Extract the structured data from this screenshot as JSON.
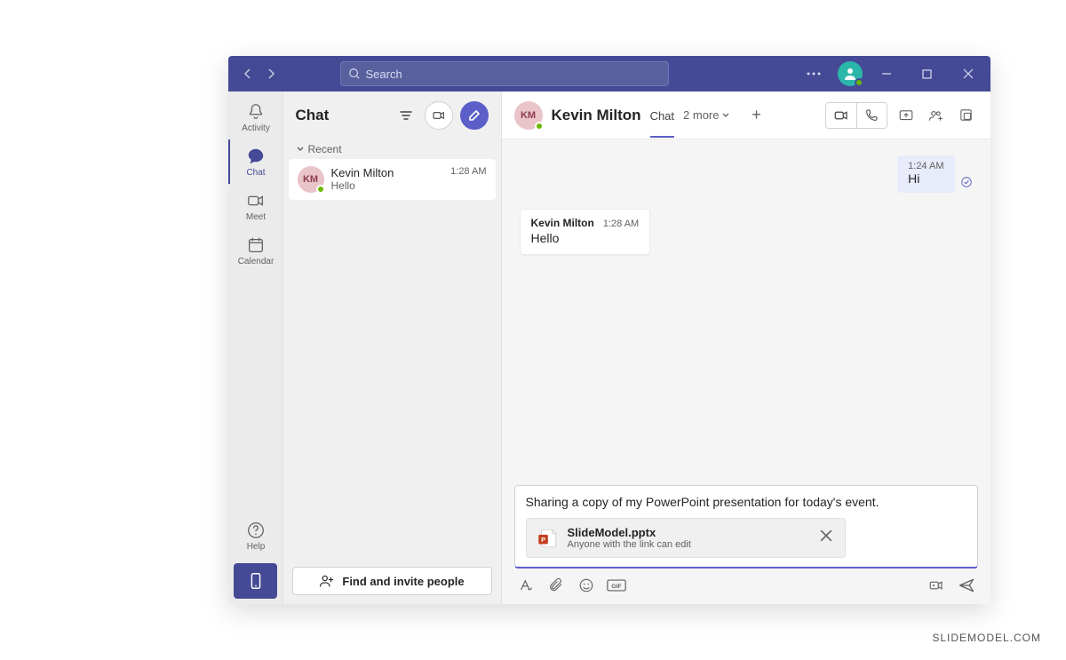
{
  "titlebar": {
    "search_placeholder": "Search"
  },
  "rail": {
    "items": [
      {
        "label": "Activity"
      },
      {
        "label": "Chat"
      },
      {
        "label": "Meet"
      },
      {
        "label": "Calendar"
      }
    ],
    "help_label": "Help"
  },
  "chatlist": {
    "title": "Chat",
    "section_recent": "Recent",
    "items": [
      {
        "initials": "KM",
        "name": "Kevin Milton",
        "preview": "Hello",
        "time": "1:28 AM"
      }
    ],
    "invite_label": "Find and invite people"
  },
  "chat_header": {
    "avatar_initials": "KM",
    "title": "Kevin Milton",
    "tab_chat": "Chat",
    "more_label": "2 more"
  },
  "messages": {
    "out": {
      "time": "1:24 AM",
      "text": "Hi"
    },
    "in": {
      "sender": "Kevin Milton",
      "time": "1:28 AM",
      "text": "Hello"
    }
  },
  "composer": {
    "draft_text": "Sharing a copy of my PowerPoint presentation for today's event.",
    "attachment": {
      "name": "SlideModel.pptx",
      "permission": "Anyone with the link can edit"
    }
  },
  "watermark": "SLIDEMODEL.COM"
}
